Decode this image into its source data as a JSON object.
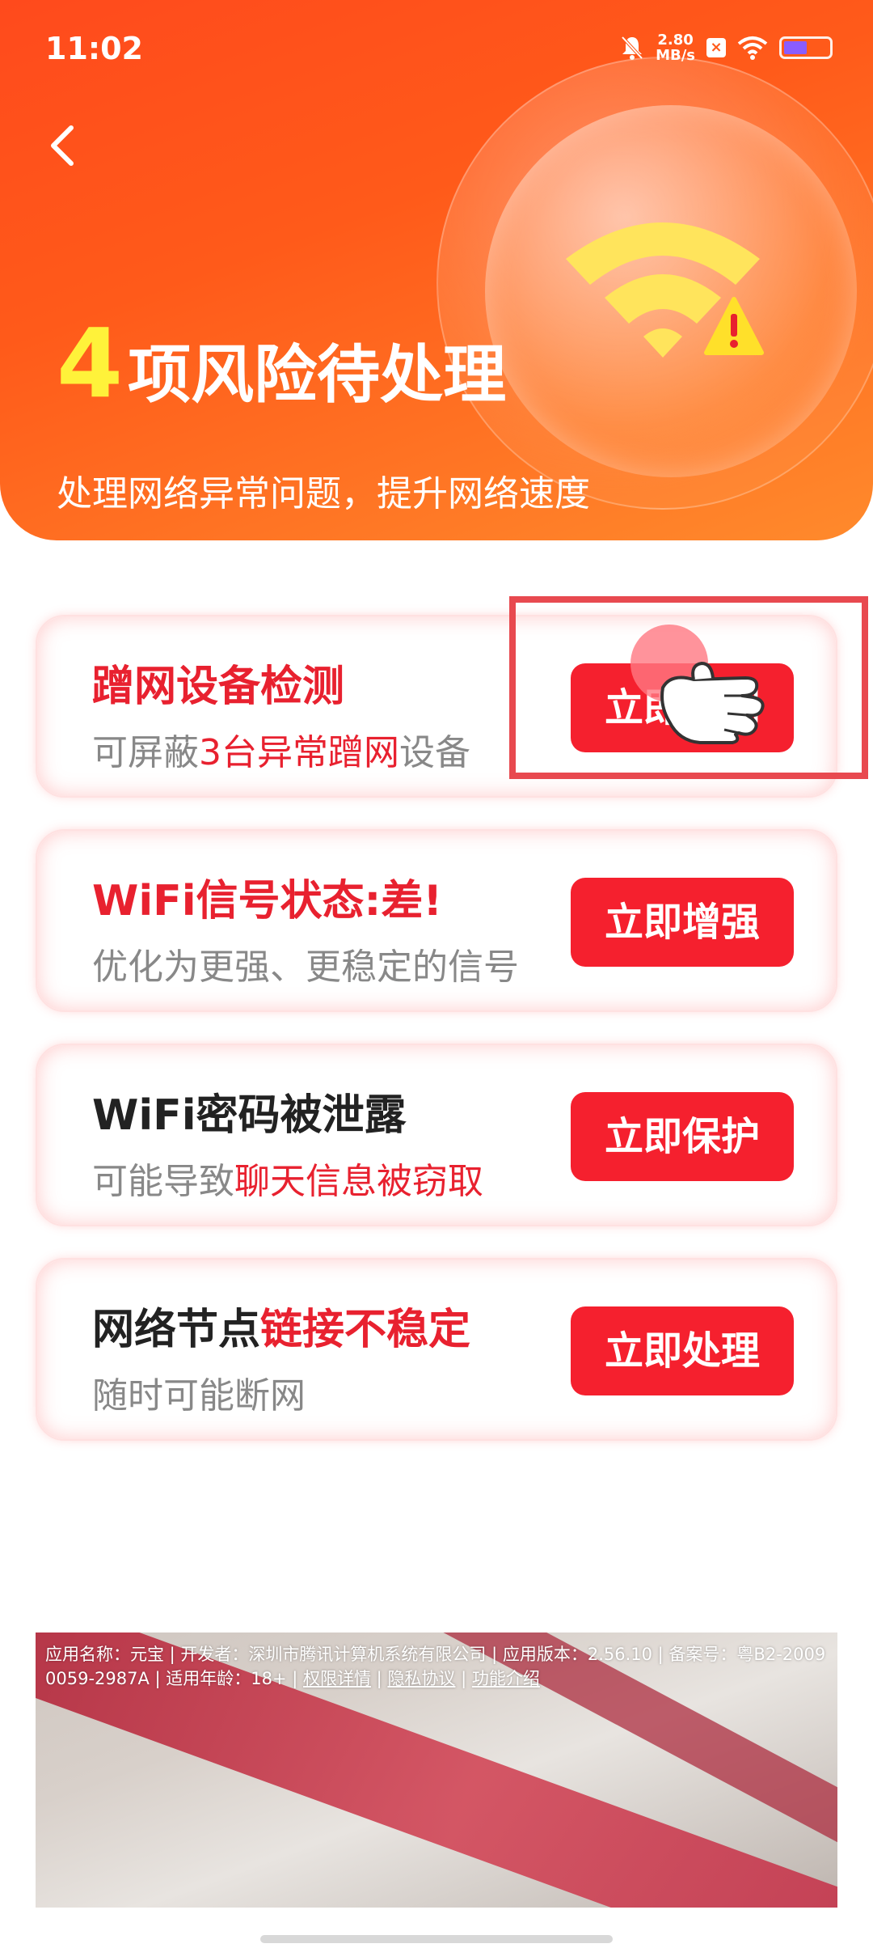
{
  "status_bar": {
    "time": "11:02",
    "net_speed_value": "2.80",
    "net_speed_unit": "MB/s",
    "icons": [
      "bell-muted-icon",
      "x-box-icon",
      "wifi-icon",
      "battery-icon"
    ]
  },
  "header": {
    "risk_count": "4",
    "risk_title": "项风险待处理",
    "subtitle": "处理网络异常问题，提升网络速度",
    "icons": [
      "back-icon",
      "wifi-warning-icon"
    ],
    "colors": {
      "gradient_start": "#ff4a1c",
      "gradient_end": "#ff8a2c",
      "count_color": "#fff23a"
    }
  },
  "cards": [
    {
      "title_parts": [
        {
          "text": "蹭网设备检测",
          "color": "red"
        }
      ],
      "desc_parts": [
        {
          "text": "可屏蔽",
          "color": "gray"
        },
        {
          "text": "3台异常蹭网",
          "color": "red"
        },
        {
          "text": "设备",
          "color": "gray"
        }
      ],
      "button": "立即检测"
    },
    {
      "title_parts": [
        {
          "text": "WiFi信号状态:差!",
          "color": "red"
        }
      ],
      "desc_parts": [
        {
          "text": "优化为更强、更稳定的信号",
          "color": "gray"
        }
      ],
      "button": "立即增强"
    },
    {
      "title_parts": [
        {
          "text": "WiFi密码被泄露",
          "color": "dark"
        }
      ],
      "desc_parts": [
        {
          "text": "可能导致",
          "color": "gray"
        },
        {
          "text": "聊天信息被窃取",
          "color": "red"
        }
      ],
      "button": "立即保护"
    },
    {
      "title_parts": [
        {
          "text": "网络节点",
          "color": "dark"
        },
        {
          "text": "链接不稳定",
          "color": "red"
        }
      ],
      "desc_parts": [
        {
          "text": "随时可能断网",
          "color": "gray"
        }
      ],
      "button": "立即处理"
    }
  ],
  "ad": {
    "info_text": "应用名称：元宝 | 开发者：深圳市腾讯计算机系统有限公司 | 应用版本：2.56.10 | 备案号：粤B2-20090059-2987A | 适用年龄：18+ | ",
    "link_permissions": "权限详情",
    "sep1": " | ",
    "link_privacy": "隐私协议",
    "sep2": " | ",
    "link_features": "功能介绍"
  },
  "overlay": {
    "icons": [
      "tap-hand-icon"
    ],
    "highlight_color": "#e8494f"
  },
  "colors": {
    "accent_red": "#f5202e",
    "text_red": "#e8212f",
    "text_gray": "#888888",
    "text_dark": "#222222"
  }
}
